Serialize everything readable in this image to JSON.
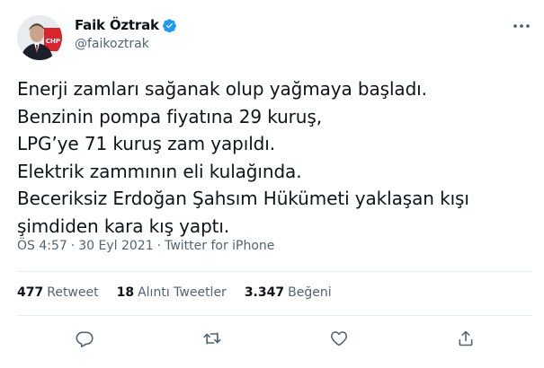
{
  "author": {
    "display_name": "Faik Öztrak",
    "handle": "@faikoztrak",
    "verified_icon": "verified-badge-icon",
    "avatar_badge_text": "CHP"
  },
  "tweet": {
    "lines": [
      "Enerji zamları sağanak olup yağmaya başladı.",
      "Benzinin pompa fiyatına 29 kuruş,",
      "LPG’ye 71 kuruş zam yapıldı.",
      "Elektrik zammının eli kulağında.",
      "Beceriksiz Erdoğan Şahsım Hükümeti yaklaşan kışı",
      "şimdiden kara kış yaptı."
    ]
  },
  "meta": {
    "time": "ÖS 4:57",
    "separator": "·",
    "date": "30 Eyl 2021",
    "source": "Twitter for iPhone"
  },
  "stats": {
    "retweets": {
      "count": "477",
      "label": "Retweet"
    },
    "quotes": {
      "count": "18",
      "label": "Alıntı Tweetler"
    },
    "likes": {
      "count": "3.347",
      "label": "Beğeni"
    }
  },
  "actions": [
    "reply-icon",
    "retweet-icon",
    "like-icon",
    "share-icon"
  ],
  "colors": {
    "verified": "#1d9bf0",
    "text": "#0f1419",
    "secondary": "#536471",
    "divider": "#e6ecf0",
    "badge_red": "#d7262d"
  }
}
